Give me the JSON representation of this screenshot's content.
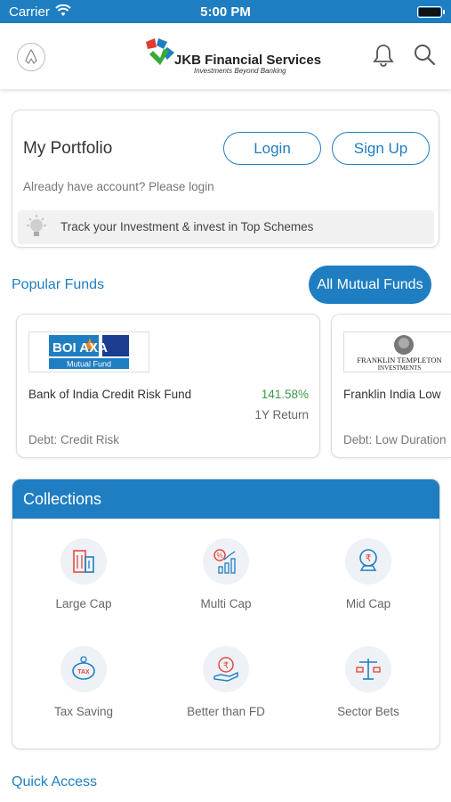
{
  "status_bar": {
    "carrier": "Carrier",
    "time": "5:00 PM"
  },
  "header": {
    "brand": "JKB Financial Services",
    "tagline": "Investments Beyond Banking",
    "icons": [
      "logo-emblem-icon",
      "bell-icon",
      "search-icon"
    ]
  },
  "portfolio": {
    "title": "My Portfolio",
    "login_label": "Login",
    "signup_label": "Sign Up",
    "hint": "Already have account? Please login",
    "track_text": "Track your Investment & invest in Top Schemes"
  },
  "popular_funds": {
    "title": "Popular Funds",
    "all_button": "All Mutual Funds",
    "funds": [
      {
        "logo_text": "BOI AXA",
        "logo_sub": "Mutual Fund",
        "name": "Bank of India Credit Risk Fund",
        "return": "141.58%",
        "return_label": "1Y Return",
        "category": "Debt: Credit Risk"
      },
      {
        "logo_text": "FRANKLIN TEMPLETON",
        "logo_sub": "INVESTMENTS",
        "name": "Franklin India Low",
        "category": "Debt: Low Duration"
      }
    ]
  },
  "collections": {
    "title": "Collections",
    "items": [
      {
        "label": "Large Cap",
        "icon": "building-icon"
      },
      {
        "label": "Multi Cap",
        "icon": "percent-growth-icon"
      },
      {
        "label": "Mid Cap",
        "icon": "rupee-coin-stand-icon"
      },
      {
        "label": "Tax Saving",
        "icon": "piggy-bank-tax-icon"
      },
      {
        "label": "Better than FD",
        "icon": "rupee-hand-icon"
      },
      {
        "label": "Sector Bets",
        "icon": "balance-scale-icon"
      }
    ]
  },
  "quick_access": {
    "title": "Quick Access"
  },
  "colors": {
    "primary": "#1f7ec1",
    "return_green": "#3a9a4a"
  }
}
